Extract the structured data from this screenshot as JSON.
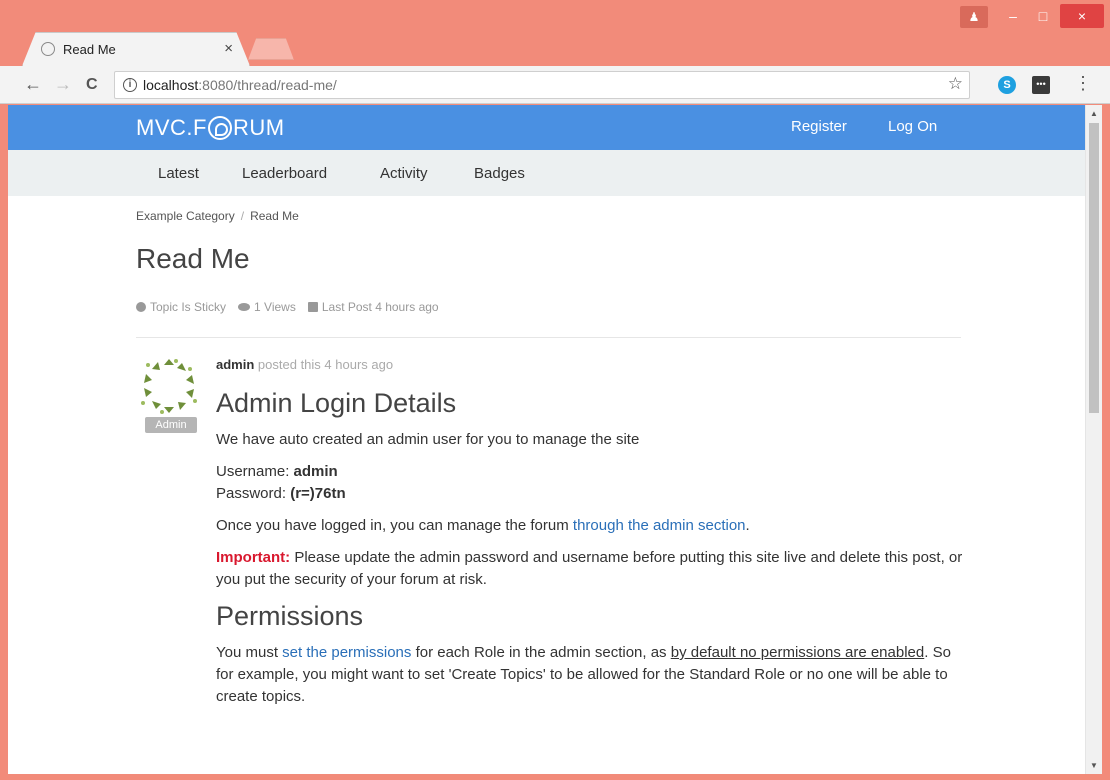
{
  "browser": {
    "tab_title": "Read Me",
    "tab_close": "×",
    "url_host": "localhost",
    "url_rest": ":8080/thread/read-me/",
    "back_glyph": "←",
    "forward_glyph": "→",
    "reload_glyph": "C",
    "info_glyph": "i",
    "star_glyph": "☆",
    "skype_label": "S",
    "ext_label": "•••",
    "menu_glyph": "⋮",
    "win_user_glyph": "♟",
    "win_min": "–",
    "win_max": "□",
    "win_close": "×"
  },
  "site": {
    "logo_prefix": "MVC.F",
    "logo_suffix": "RUM",
    "header_links": [
      "Register",
      "Log On"
    ],
    "nav": [
      "Latest",
      "Leaderboard",
      "Activity",
      "Badges"
    ],
    "accent": "#4a90e2"
  },
  "breadcrumb": {
    "category": "Example Category",
    "separator": "/",
    "current": "Read Me"
  },
  "topic": {
    "title": "Read Me",
    "sticky": "Topic Is Sticky",
    "views": "1 Views",
    "last_post": "Last Post 4 hours ago"
  },
  "post": {
    "author": "admin",
    "posted": "posted this 4 hours ago",
    "role_badge": "Admin",
    "h_login": "Admin Login Details",
    "p_intro": "We have auto created an admin user for you to manage the site",
    "username_label": "Username:",
    "username_value": "admin",
    "password_label": "Password:",
    "password_value": "(r=)76tn",
    "p_manage_pre": "Once you have logged in, you can manage the forum",
    "p_manage_link": "through the admin section",
    "p_manage_post": ".",
    "important_label": "Important:",
    "important_text": "Please update the admin password and username before putting this site live and delete this post, or you put the security of your forum at risk.",
    "h_permissions": "Permissions",
    "perm_pre": "You must",
    "perm_link": "set the permissions",
    "perm_mid": "for each Role in the admin section, as",
    "perm_underline": "by default no permissions are enabled",
    "perm_post": ". So for example, you might want to set 'Create Topics' to be allowed for the Standard Role or no one will be able to create topics."
  }
}
